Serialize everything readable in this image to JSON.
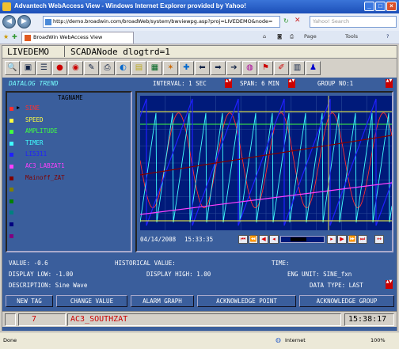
{
  "window": {
    "title": "Advantech WebAccess View - Windows Internet Explorer provided by Yahoo!"
  },
  "browser": {
    "address": "http://demo.broadwin.com/broadWeb/system/bwviewpg.asp?proj=LIVEDEMO&node=",
    "search_placeholder": "Yahoo! Search",
    "tab_label": "BroadWin WebAccess View",
    "page_menu": "Page",
    "tools_menu": "Tools"
  },
  "header": {
    "project": "LIVEDEMO",
    "node": "SCADANode dlogtrd=1"
  },
  "trend": {
    "title": "DATALOG TREND",
    "interval": "INTERVAL: 1 SEC",
    "span": "SPAN: 6 MIN",
    "group": "GROUP NO:1",
    "tagname_header": "TAGNAME",
    "date": "04/14/2008",
    "time": "15:33:35",
    "tags": [
      {
        "name": "SINE",
        "color": "#ff3030",
        "selected": true
      },
      {
        "name": "SPEED",
        "color": "#ffff40",
        "selected": false
      },
      {
        "name": "AMPLITUDE",
        "color": "#40ff40",
        "selected": false
      },
      {
        "name": "TIMER",
        "color": "#40ffff",
        "selected": false
      },
      {
        "name": "LI5311",
        "color": "#2020ff",
        "selected": false
      },
      {
        "name": "AC3_LABZAT1",
        "color": "#ff40ff",
        "selected": false
      },
      {
        "name": "Mainoff_ZAT",
        "color": "#800000",
        "selected": false
      },
      {
        "name": "",
        "color": "#808000",
        "selected": false
      },
      {
        "name": "",
        "color": "#008000",
        "selected": false
      },
      {
        "name": "",
        "color": "#008080",
        "selected": false
      },
      {
        "name": "",
        "color": "#000080",
        "selected": false
      },
      {
        "name": "",
        "color": "#800080",
        "selected": false
      }
    ]
  },
  "info": {
    "value": "VALUE: -0.6",
    "historical": "HISTORICAL VALUE:",
    "time_label": "TIME:",
    "display_low": "DISPLAY LOW: -1.00",
    "display_high": "DISPLAY HIGH: 1.00",
    "eng_unit": "ENG UNIT: SINE_fxn",
    "description": "DESCRIPTION: Sine Wave",
    "data_type": "DATA TYPE: LAST"
  },
  "buttons": {
    "new_tag": "NEW TAG",
    "change_value": "CHANGE VALUE",
    "alarm_graph": "ALARM GRAPH",
    "ack_point": "ACKNOWLEDGE POINT",
    "ack_group": "ACKNOWLEDGE GROUP"
  },
  "alarm": {
    "number": "7",
    "tag": "AC3_SOUTHZAT",
    "clock": "15:38:17"
  },
  "status": {
    "left": "Done",
    "zone": "Internet",
    "zoom": "100%"
  }
}
